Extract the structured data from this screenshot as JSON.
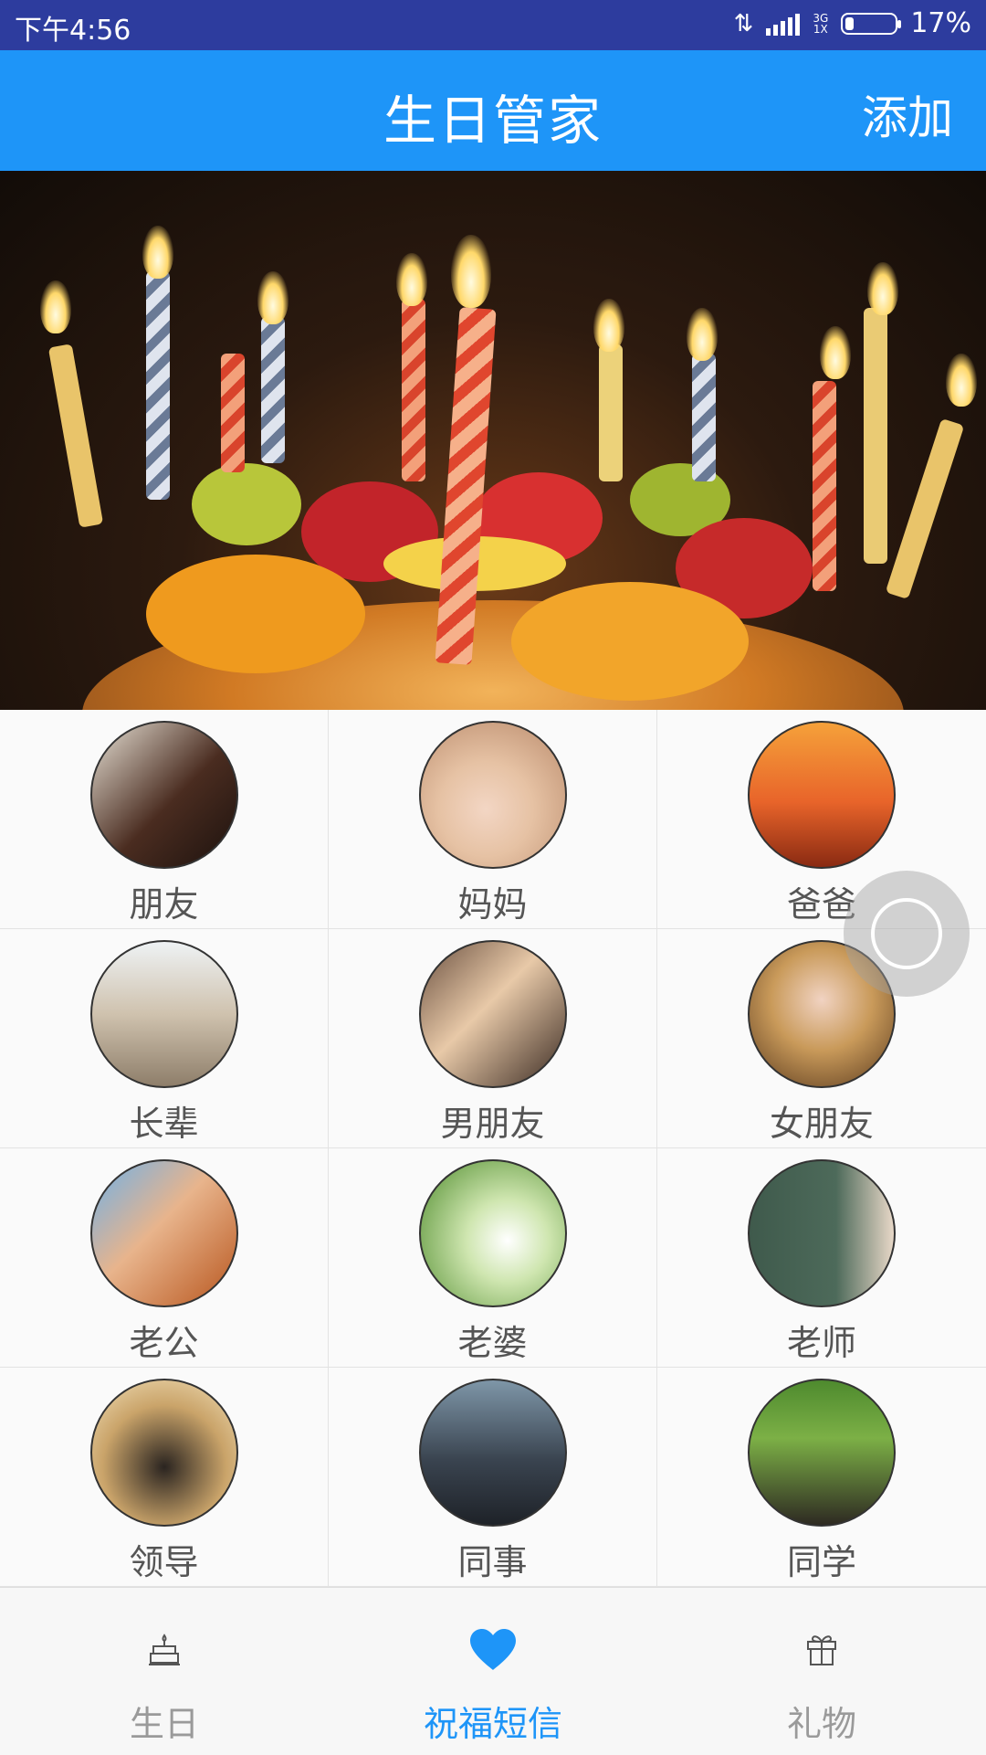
{
  "status_bar": {
    "time": "下午4:56",
    "network": "3G",
    "network_sub": "1X",
    "battery_percent_text": "17%",
    "battery_level": 0.17
  },
  "app_bar": {
    "title": "生日管家",
    "add_label": "添加"
  },
  "banner": {
    "icon": "birthday-cake-photo"
  },
  "categories": [
    {
      "label": "朋友"
    },
    {
      "label": "妈妈"
    },
    {
      "label": "爸爸"
    },
    {
      "label": "长辈"
    },
    {
      "label": "男朋友"
    },
    {
      "label": "女朋友"
    },
    {
      "label": "老公"
    },
    {
      "label": "老婆"
    },
    {
      "label": "老师"
    },
    {
      "label": "领导"
    },
    {
      "label": "同事"
    },
    {
      "label": "同学"
    }
  ],
  "tabs": [
    {
      "label": "生日",
      "icon": "cake-icon",
      "active": false
    },
    {
      "label": "祝福短信",
      "icon": "heart-icon",
      "active": true
    },
    {
      "label": "礼物",
      "icon": "gift-icon",
      "active": false
    }
  ],
  "colors": {
    "status_bar": "#2d3c9e",
    "app_bar": "#1e95f8",
    "accent": "#1e95f8",
    "inactive_text": "#9a9a9a"
  }
}
